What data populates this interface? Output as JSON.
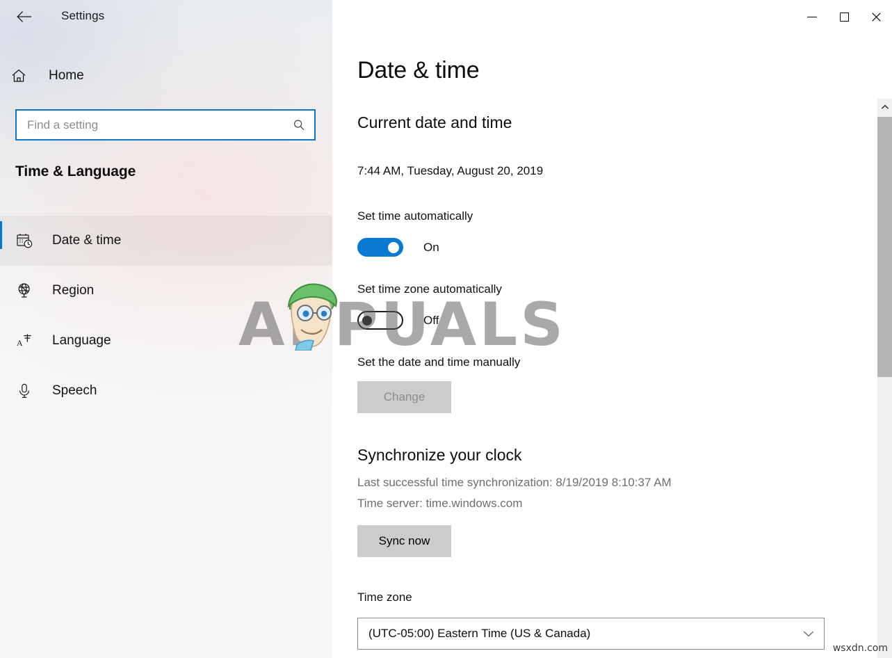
{
  "window": {
    "title": "Settings",
    "back_icon": "back-arrow-icon",
    "controls": {
      "minimize": "minimize-icon",
      "maximize": "maximize-icon",
      "close": "close-icon"
    }
  },
  "sidebar": {
    "home": {
      "label": "Home",
      "icon": "home-icon"
    },
    "search": {
      "value": "",
      "placeholder": "Find a setting",
      "icon": "search-icon"
    },
    "group_title": "Time & Language",
    "items": [
      {
        "label": "Date & time",
        "icon": "calendar-clock-icon",
        "selected": true
      },
      {
        "label": "Region",
        "icon": "globe-icon",
        "selected": false
      },
      {
        "label": "Language",
        "icon": "translate-icon",
        "selected": false
      },
      {
        "label": "Speech",
        "icon": "microphone-icon",
        "selected": false
      }
    ]
  },
  "main": {
    "page_title": "Date & time",
    "current": {
      "heading": "Current date and time",
      "value": "7:44 AM, Tuesday, August 20, 2019"
    },
    "set_time_auto": {
      "label": "Set time automatically",
      "state": "On",
      "on": true
    },
    "set_timezone_auto": {
      "label": "Set time zone automatically",
      "state": "Off",
      "on": false
    },
    "manual": {
      "label": "Set the date and time manually",
      "button_label": "Change",
      "button_disabled": true
    },
    "sync": {
      "heading": "Synchronize your clock",
      "last_sync": "Last successful time synchronization: 8/19/2019 8:10:37 AM",
      "time_server": "Time server: time.windows.com",
      "button_label": "Sync now"
    },
    "timezone": {
      "label": "Time zone",
      "value": "(UTC-05:00) Eastern Time (US & Canada)",
      "chevron_icon": "chevron-down-icon"
    }
  },
  "scrollbar": {
    "up_arrow_icon": "chevron-up-icon"
  },
  "watermarks": {
    "brand": "APPUALS",
    "corner": "wsxdn.com"
  },
  "colors": {
    "accent": "#0078d7",
    "toggle_on": "#0a79d1",
    "search_border": "#0b76c8",
    "button_bg": "#cccccc",
    "button_disabled_text": "#8c8c8c",
    "sidebar_base": "#f6f6f7",
    "content_bg": "#ffffff"
  }
}
